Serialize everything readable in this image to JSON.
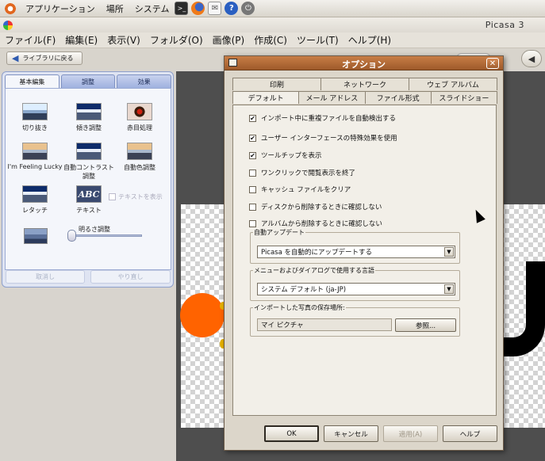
{
  "top_panel": {
    "menus": [
      "アプリケーション",
      "場所",
      "システム"
    ],
    "icons": [
      "terminal-icon",
      "firefox-icon",
      "mail-icon",
      "help-icon",
      "power-icon"
    ]
  },
  "app": {
    "title": "Picasa 3"
  },
  "menubar": [
    "ファイル(F)",
    "編集(E)",
    "表示(V)",
    "フォルダ(O)",
    "画像(P)",
    "作成(C)",
    "ツール(T)",
    "ヘルプ(H)"
  ],
  "toolbar": {
    "back_label": "ライブラリに戻る"
  },
  "left_panel": {
    "tabs": [
      "基本編集",
      "調整",
      "効果"
    ],
    "tools": [
      "切り抜き",
      "傾き調整",
      "赤目処理",
      "I'm Feeling Lucky",
      "自動コントラスト調整",
      "自動色調整",
      "レタッチ",
      "テキスト"
    ],
    "abc_text": "ABC",
    "fade_label": "テキストを表示",
    "brightness_label": "明るさ調整",
    "brightness_level": 0.0,
    "undo_label": "取消し",
    "redo_label": "やり直し"
  },
  "dialog": {
    "title": "オプション",
    "tabs_row1": [
      "印刷",
      "ネットワーク",
      "ウェブ アルバム"
    ],
    "tabs_row2": [
      "デフォルト",
      "メール アドレス",
      "ファイル形式",
      "スライドショー"
    ],
    "options": [
      {
        "label": "インポート中に重複ファイルを自動検出する",
        "checked": true
      },
      {
        "label": "ユーザー インターフェースの特殊効果を使用",
        "checked": true
      },
      {
        "label": "ツールチップを表示",
        "checked": true
      },
      {
        "label": "ワンクリックで閲覧表示を終了",
        "checked": false
      },
      {
        "label": "キャッシュ ファイルをクリア",
        "checked": false
      },
      {
        "label": "ディスクから削除するときに確認しない",
        "checked": false
      },
      {
        "label": "アルバムから削除するときに確認しない",
        "checked": false
      }
    ],
    "auto_update": {
      "legend": "自動アップデート",
      "selected": "Picasa を自動的にアップデートする"
    },
    "language": {
      "legend": "メニューおよびダイアログで使用する言語",
      "selected": "システム デフォルト (ja-JP)"
    },
    "import_location": {
      "legend": "インポートした写真の保存場所:",
      "value": "マイ ピクチャ",
      "browse_label": "参照..."
    },
    "buttons": {
      "ok": "OK",
      "cancel": "キャンセル",
      "apply": "適用(A)",
      "help": "ヘルプ"
    }
  },
  "colors": {
    "dialog_title": "#b06a35",
    "orange_disc": "#ff6300",
    "left_panel_border": "#8ea0cc"
  }
}
